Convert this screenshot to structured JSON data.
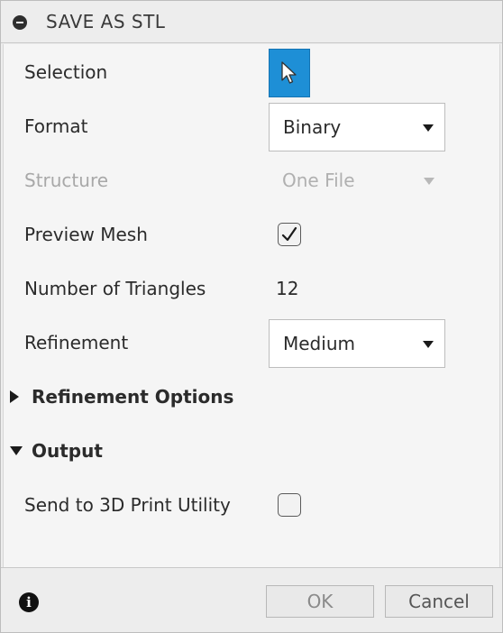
{
  "dialog": {
    "title": "SAVE AS STL"
  },
  "fields": {
    "selection_label": "Selection",
    "format_label": "Format",
    "format_value": "Binary",
    "structure_label": "Structure",
    "structure_value": "One File",
    "preview_mesh_label": "Preview Mesh",
    "preview_mesh_checked": true,
    "triangles_label": "Number of Triangles",
    "triangles_value": "12",
    "refinement_label": "Refinement",
    "refinement_value": "Medium"
  },
  "groups": {
    "refinement_options": "Refinement Options",
    "output": "Output"
  },
  "output": {
    "send_to_3d_label": "Send to 3D Print Utility",
    "send_to_3d_checked": false
  },
  "footer": {
    "ok_label": "OK",
    "cancel_label": "Cancel"
  },
  "colors": {
    "accent": "#1e8fd6"
  }
}
